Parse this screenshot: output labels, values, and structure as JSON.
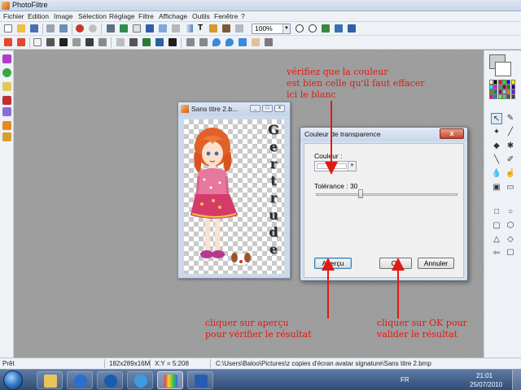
{
  "app": {
    "title": "PhotoFiltre"
  },
  "menu": [
    "Fichier",
    "Edition",
    "Image",
    "Sélection",
    "Réglage",
    "Filtre",
    "Affichage",
    "Outils",
    "Fenêtre",
    "?"
  ],
  "toolbar": {
    "zoom_value": "100%"
  },
  "image_window": {
    "title": "Sans titre 2.b...",
    "letters": [
      "G",
      "e",
      "r",
      "t",
      "r",
      "u",
      "d",
      "e"
    ]
  },
  "dialog": {
    "title": "Couleur de transparence",
    "couleur_label": "Couleur :",
    "couleur_value": "#ffffff",
    "tolerance_label": "Tolérance : 30",
    "tolerance_value": 30,
    "apercu_label": "Aperçu",
    "ok_label": "Ok",
    "annuler_label": "Annuler",
    "close_label": "x"
  },
  "annotations": {
    "note1": [
      "vérifiez que la couleur",
      "est bien celle qu'il faut effacer",
      "ici le blanc"
    ],
    "note2": [
      "cliquer sur aperçu",
      "pour vérifier le résultat"
    ],
    "note3": [
      "cliquer sur OK pour",
      "valider le résultat"
    ],
    "color": "#e01b12"
  },
  "status": {
    "state": "Prêt",
    "dimensions": "182x289x16M",
    "coords": "X:Y = 5:208",
    "path": "C:\\Users\\Baloo\\Pictures\\z copies d'écran avatar signature\\Sans titre 2.bmp"
  },
  "taskbar": {
    "lang": "FR",
    "time": "21:01",
    "date": "25/07/2010",
    "apps": [
      "explorer",
      "media-player",
      "hp",
      "internet-explorer",
      "photofiltre",
      "word"
    ]
  },
  "palette_colors": [
    "#ffffff",
    "#000000",
    "#ff0000",
    "#00ff00",
    "#0000ff",
    "#ffff00",
    "#00ffff",
    "#ff00ff",
    "#808080",
    "#800000",
    "#008000",
    "#000080",
    "#808000",
    "#008080",
    "#800080",
    "#c0c0c0",
    "#ff8000",
    "#8000ff",
    "#ff0080",
    "#0080ff",
    "#80ff00",
    "#00ff80",
    "#804000",
    "#404040"
  ]
}
